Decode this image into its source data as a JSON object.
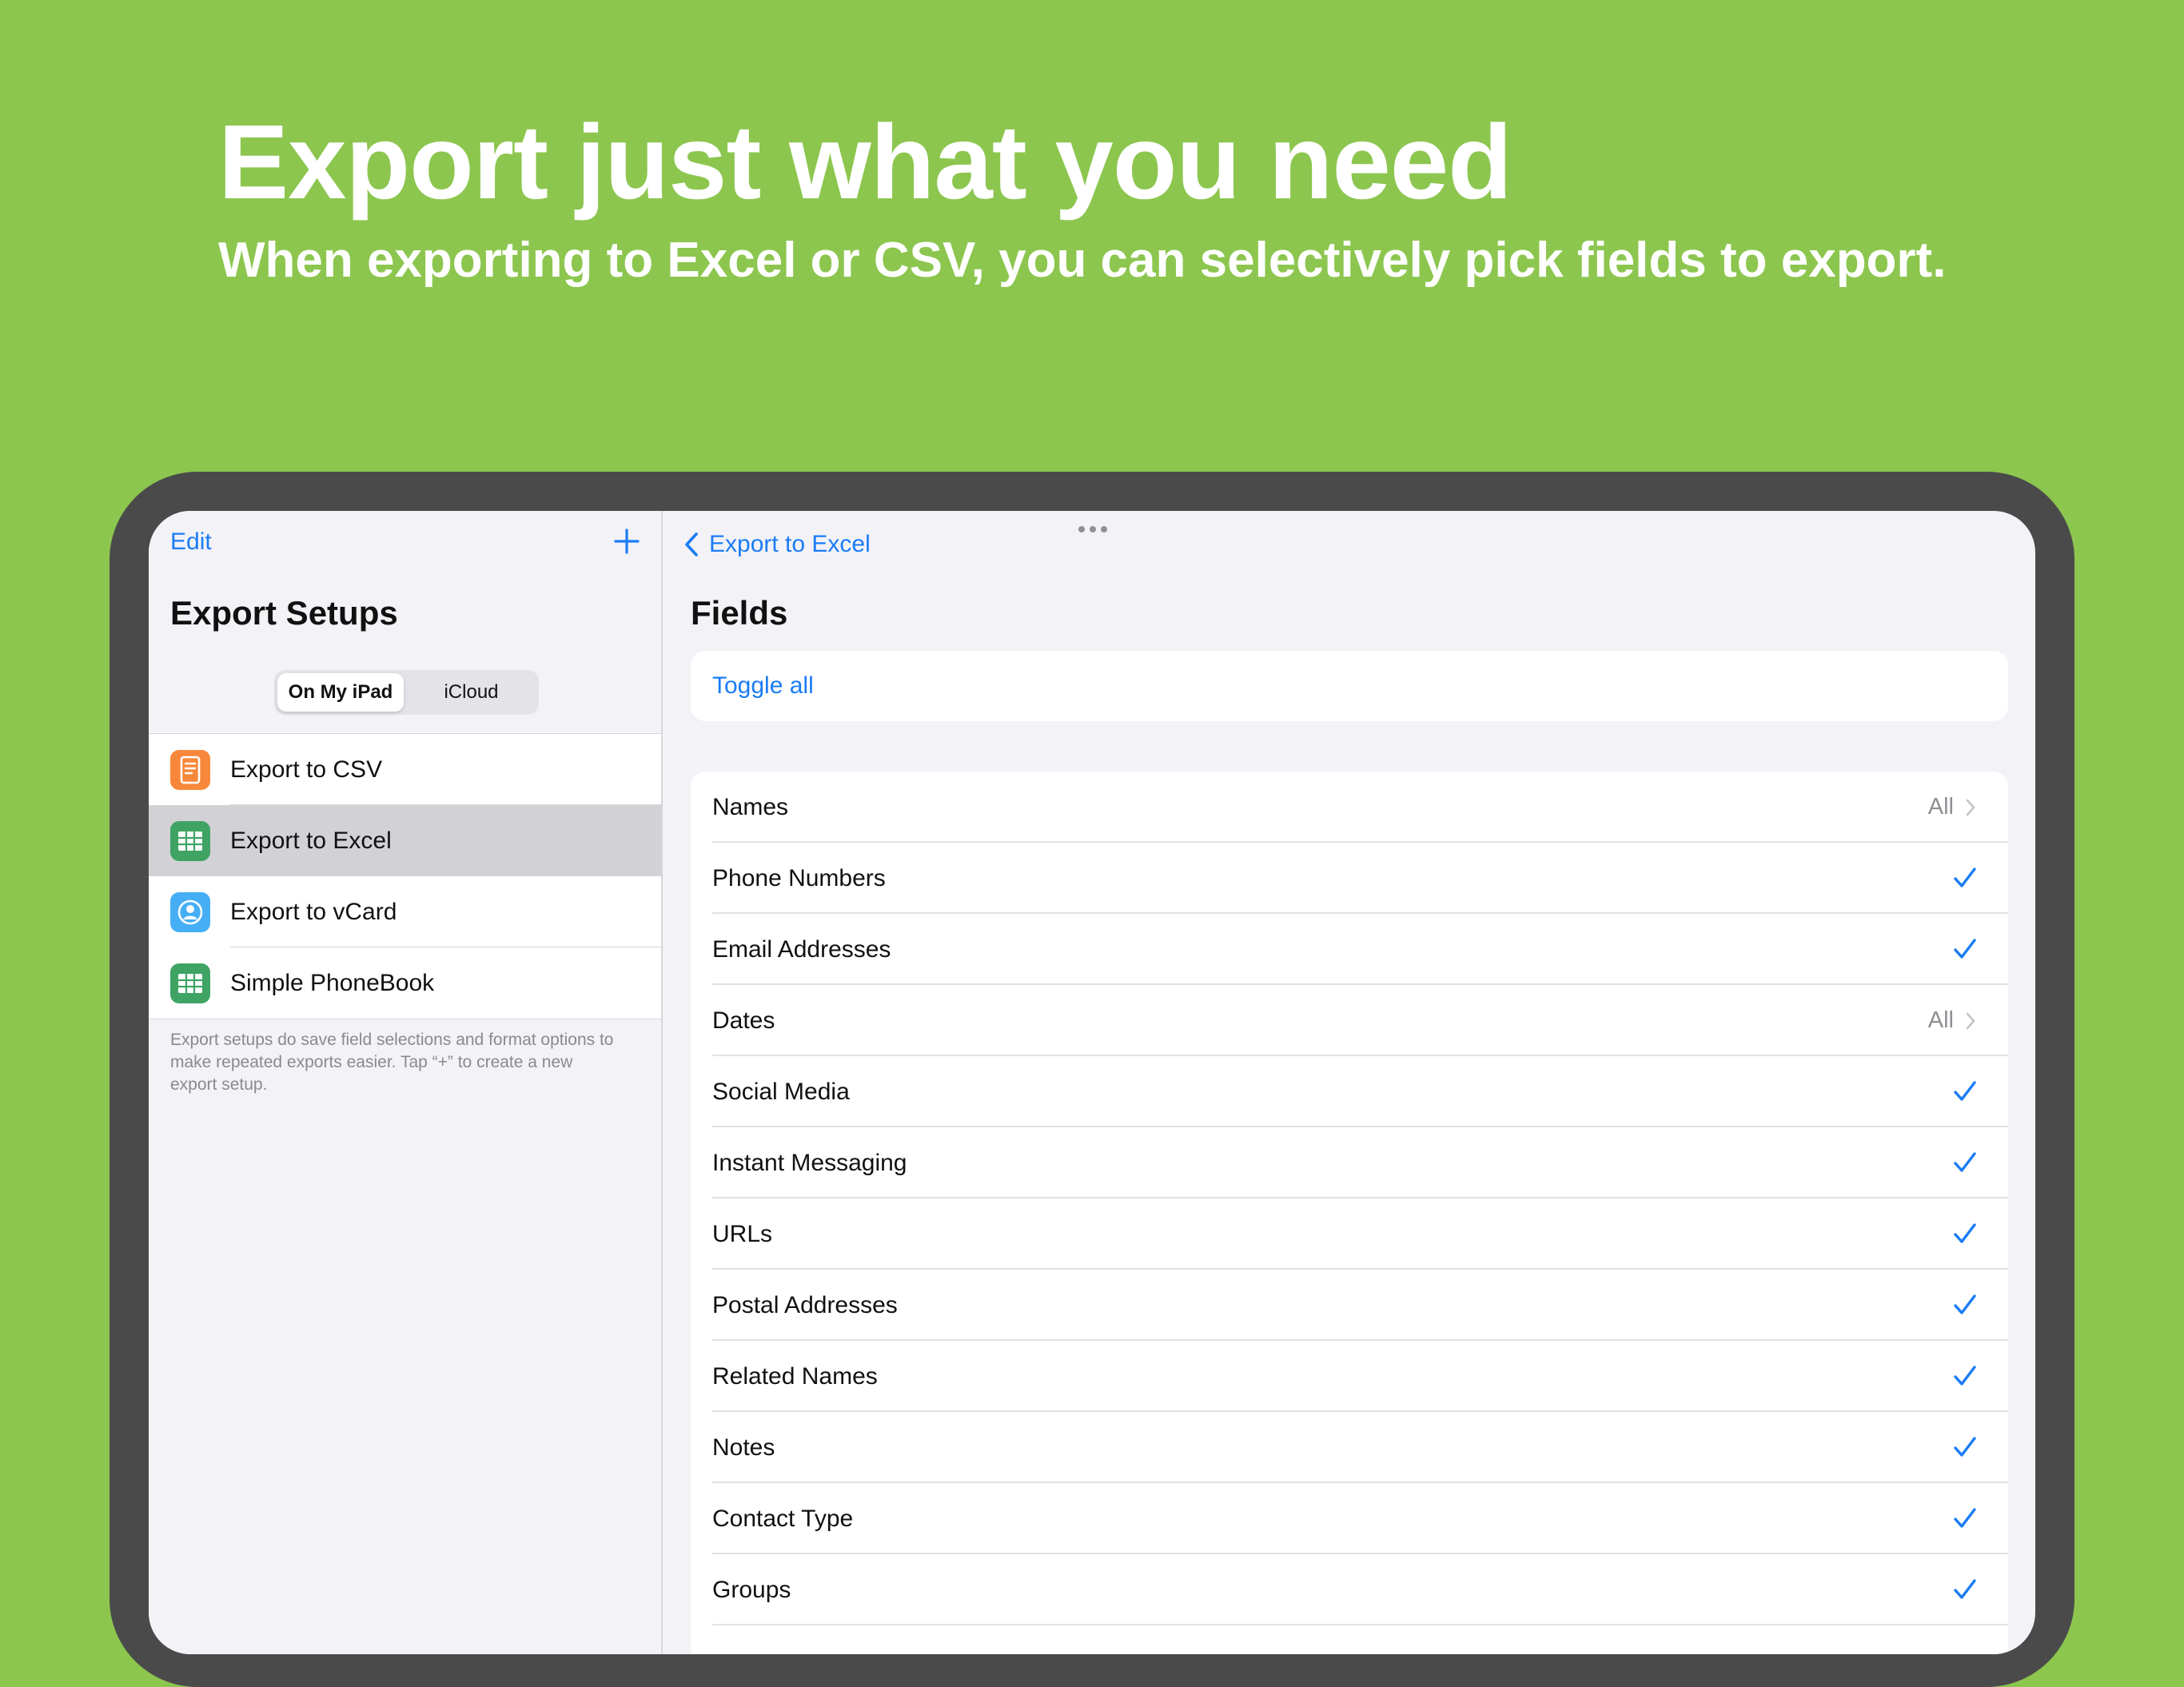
{
  "headline": "Export just what you need",
  "subheadline": "When exporting to Excel or CSV, you can selectively pick fields to export.",
  "colors": {
    "background": "#8cc64f",
    "accent": "#1a7cf5",
    "csv_icon": "#f7883b",
    "excel_icon": "#3fa364",
    "vcard_icon": "#45aef5"
  },
  "sidebar": {
    "edit_label": "Edit",
    "add_icon": "plus-icon",
    "title": "Export Setups",
    "segments": [
      "On My iPad",
      "iCloud"
    ],
    "selected_segment": "On My iPad",
    "items": [
      {
        "label": "Export to CSV",
        "icon": "csv-document-icon"
      },
      {
        "label": "Export to Excel",
        "icon": "excel-grid-icon",
        "selected": true
      },
      {
        "label": "Export to vCard",
        "icon": "vcard-contact-icon"
      },
      {
        "label": "Simple PhoneBook",
        "icon": "excel-grid-icon"
      }
    ],
    "footnote": "Export setups do save field selections and format options to make repeated exports easier. Tap “+” to create a new export setup."
  },
  "detail": {
    "back_label": "Export to Excel",
    "title": "Fields",
    "toggle_all": "Toggle all",
    "fields": [
      {
        "label": "Names",
        "value": "All",
        "accessory": "disclosure"
      },
      {
        "label": "Phone Numbers",
        "accessory": "checkmark"
      },
      {
        "label": "Email Addresses",
        "accessory": "checkmark"
      },
      {
        "label": "Dates",
        "value": "All",
        "accessory": "disclosure"
      },
      {
        "label": "Social Media",
        "accessory": "checkmark"
      },
      {
        "label": "Instant Messaging",
        "accessory": "checkmark"
      },
      {
        "label": "URLs",
        "accessory": "checkmark"
      },
      {
        "label": "Postal Addresses",
        "accessory": "checkmark"
      },
      {
        "label": "Related Names",
        "accessory": "checkmark"
      },
      {
        "label": "Notes",
        "accessory": "checkmark"
      },
      {
        "label": "Contact Type",
        "accessory": "checkmark"
      },
      {
        "label": "Groups",
        "accessory": "checkmark"
      }
    ]
  }
}
